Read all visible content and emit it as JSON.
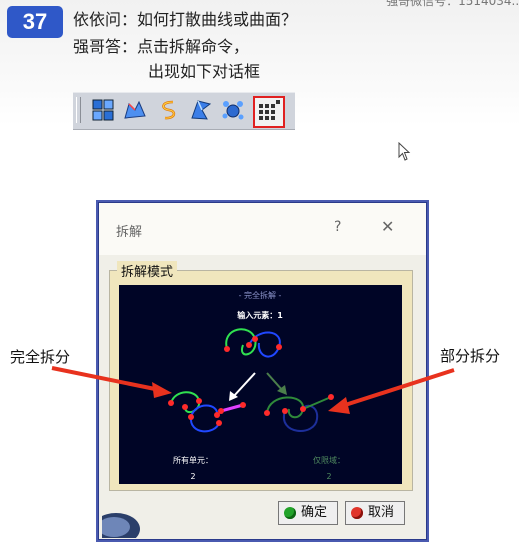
{
  "slide": {
    "number": "37",
    "question": "依依问：如何打散曲线或曲面？",
    "answer_line1": "强哥答：点击拆解命令，",
    "answer_line2": "出现如下对话框",
    "corner_note": "强哥微信号：1514034..."
  },
  "toolbar": {
    "icons": [
      "join-icon",
      "healing-icon",
      "curve-smooth-icon",
      "untrim-icon",
      "disassemble-icon-a",
      "disassemble-icon"
    ]
  },
  "dialog": {
    "title": "拆解",
    "help": "?",
    "close": "✕",
    "group_label": "拆解模式",
    "preview": {
      "header": "- 完全拆解 -",
      "input_label": "输入元素：1",
      "left_label": "所有单元：",
      "left_count": "2",
      "right_label": "仅限域：",
      "right_count": "2"
    },
    "ok_label": "确定",
    "cancel_label": "取消"
  },
  "annotations": {
    "left": "完全拆分",
    "right": "部分拆分"
  },
  "colors": {
    "badge": "#2f58c8",
    "arrow": "#e8321e",
    "preview_bg": "#000526",
    "active_border": "#e02020"
  }
}
